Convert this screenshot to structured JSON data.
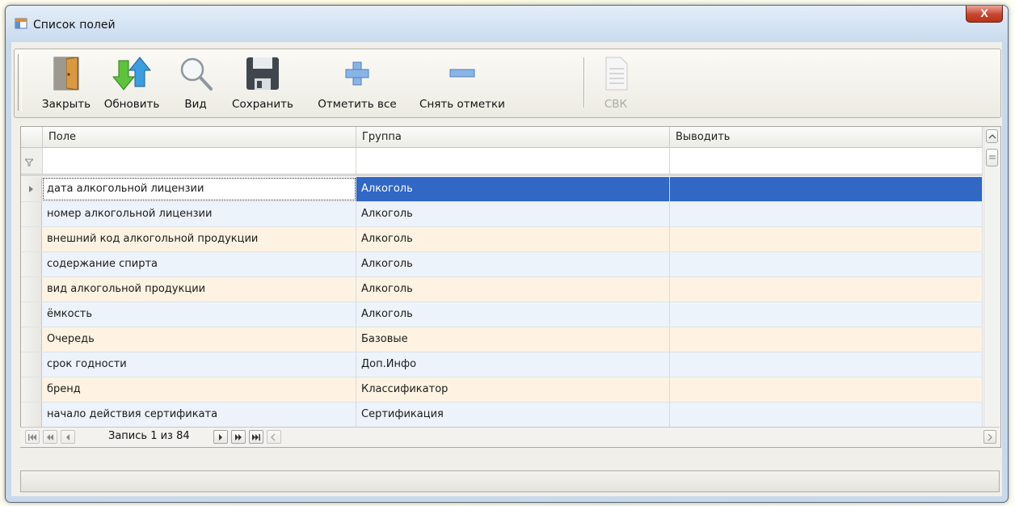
{
  "window": {
    "title": "Список полей",
    "close_glyph": "X",
    "icon": "table-window-icon"
  },
  "toolbar": {
    "buttons": [
      {
        "label": "Закрыть",
        "icon": "door-icon",
        "enabled": true
      },
      {
        "label": "Обновить",
        "icon": "refresh-arrows-icon",
        "enabled": true
      },
      {
        "label": "Вид",
        "icon": "magnifier-icon",
        "enabled": true
      },
      {
        "label": "Сохранить",
        "icon": "floppy-disk-icon",
        "enabled": true
      },
      {
        "label": "Отметить все",
        "icon": "plus-icon",
        "enabled": true
      },
      {
        "label": "Снять отметки",
        "icon": "minus-icon",
        "enabled": true
      },
      {
        "label": "СВК",
        "icon": "document-icon",
        "enabled": false
      }
    ]
  },
  "grid": {
    "columns": [
      "Поле",
      "Группа",
      "Выводить"
    ],
    "rows": [
      {
        "field": "дата алкогольной лицензии",
        "group": "Алкоголь",
        "output": "",
        "selected": true
      },
      {
        "field": "номер алкогольной лицензии",
        "group": "Алкоголь",
        "output": ""
      },
      {
        "field": "внешний код алкогольной продукции",
        "group": "Алкоголь",
        "output": ""
      },
      {
        "field": "содержание спирта",
        "group": "Алкоголь",
        "output": ""
      },
      {
        "field": "вид алкогольной продукции",
        "group": "Алкоголь",
        "output": ""
      },
      {
        "field": "ёмкость",
        "group": "Алкоголь",
        "output": ""
      },
      {
        "field": "Очередь",
        "group": "Базовые",
        "output": ""
      },
      {
        "field": "срок годности",
        "group": "Доп.Инфо",
        "output": ""
      },
      {
        "field": "бренд",
        "group": "Классификатор",
        "output": ""
      },
      {
        "field": "начало действия сертификата",
        "group": "Сертификация",
        "output": ""
      }
    ]
  },
  "navigator": {
    "record_text": "Запись 1 из 84"
  },
  "colors": {
    "selection": "#3167c5",
    "row_alt_blue": "#edf3fa",
    "row_alt_cream": "#fef3e2"
  }
}
